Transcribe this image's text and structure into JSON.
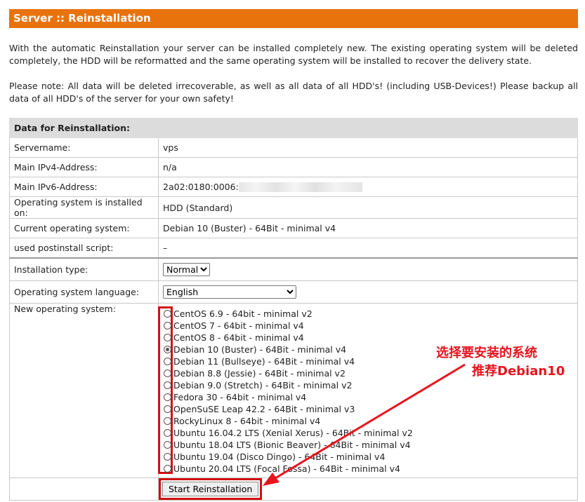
{
  "header": {
    "title": "Server :: Reinstallation"
  },
  "intro": "With the automatic Reinstallation your server can be installed completely new. The existing operating system will be deleted completely, the HDD will be reformatted and the same operating system will be installed to recover the delivery state.",
  "note": "Please note: All data will be deleted irrecoverable, as well as all data of all HDD's! (including USB-Devices!) Please backup all data of all HDD's of the server for your own safety!",
  "section_title": "Data for Reinstallation:",
  "rows": {
    "servername": {
      "label": "Servername:",
      "value": "vps"
    },
    "ipv4": {
      "label": "Main IPv4-Address:",
      "value": "n/a"
    },
    "ipv6": {
      "label": "Main IPv6-Address:",
      "value": "2a02:0180:0006:"
    },
    "installed_on": {
      "label": "Operating system is installed on:",
      "value": "HDD (Standard)"
    },
    "current_os": {
      "label": "Current operating system:",
      "value": "Debian 10 (Buster) - 64Bit - minimal v4"
    },
    "postinstall": {
      "label": "used postinstall script:",
      "value": "–"
    }
  },
  "install_type": {
    "label": "Installation type:",
    "selected": "Normal"
  },
  "language": {
    "label": "Operating system language:",
    "selected": "English"
  },
  "new_os": {
    "label": "New operating system:",
    "options": [
      "CentOS 6.9 - 64bit - minimal v2",
      "CentOS 7 - 64bit - minimal v4",
      "CentOS 8 - 64bit - minimal v4",
      "Debian 10 (Buster) - 64Bit - minimal v4",
      "Debian 11 (Bullseye) - 64Bit - minimal v4",
      "Debian 8.8 (Jessie) - 64Bit - minimal v2",
      "Debian 9.0 (Stretch) - 64Bit - minimal v2",
      "Fedora 30 - 64bit - minimal v4",
      "OpenSuSE Leap 42.2 - 64Bit - minimal v3",
      "RockyLinux 8 - 64bit - minimal v4",
      "Ubuntu 16.04.2 LTS (Xenial Xerus) - 64Bit - minimal v2",
      "Ubuntu 18.04 LTS (Bionic Beaver) - 64Bit - minimal v4",
      "Ubuntu 19.04 (Disco Dingo) - 64Bit - minimal v4",
      "Ubuntu 20.04 LTS (Focal Fossa) - 64Bit - minimal v4"
    ],
    "selected": "Debian 10 (Buster) - 64Bit - minimal v4"
  },
  "submit_label": "Start Reinstallation",
  "annotation": {
    "line1": "选择要安装的系统",
    "line2": "推荐Debian10",
    "color": "#e8141e"
  },
  "colors": {
    "header_bg": "#e8720c",
    "highlight": "#d01010"
  }
}
